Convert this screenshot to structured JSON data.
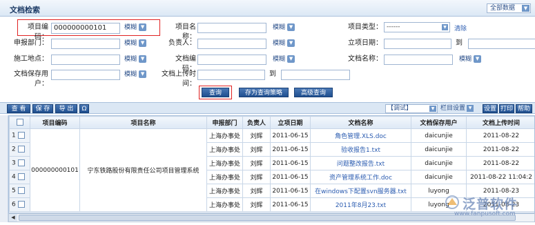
{
  "header": {
    "title": "文档检索",
    "all_data": "全部数据"
  },
  "form": {
    "project_code_label": "项目编码：",
    "project_code_value": "000000000101",
    "project_code_mode": "模糊",
    "project_name_label": "项目名称：",
    "project_name_mode": "模糊",
    "project_type_label": "项目类型：",
    "project_type_value": "------",
    "clear_label": "清除",
    "dept_label": "申报部门：",
    "dept_mode": "模糊",
    "owner_label": "负责人：",
    "owner_mode": "模糊",
    "setup_date_label": "立项日期：",
    "to_label": "到",
    "site_label": "施工地点：",
    "site_mode": "模糊",
    "doc_code_label": "文档编码：",
    "doc_code_mode": "模糊",
    "doc_name_label": "文档名称：",
    "doc_name_mode": "模糊",
    "doc_user_label": "文档保存用户：",
    "doc_user_mode": "模糊",
    "upload_time_label": "文档上传时间：",
    "upload_to_label": "到"
  },
  "buttons": {
    "query": "查询",
    "save_strategy": "存为查询策略",
    "advanced": "高级查询"
  },
  "toolbar": {
    "view": "查 看",
    "save": "保 存",
    "export": "导 出",
    "omega": "Ω",
    "debug_select": "【调试】",
    "column_settings": "栏目设置",
    "settings": "设置",
    "print": "打印",
    "help": "帮助"
  },
  "table": {
    "columns": [
      "",
      "项目编码",
      "项目名称",
      "申报部门",
      "负责人",
      "立项日期",
      "文档名称",
      "文档保存用户",
      "文档上传时间"
    ],
    "project_code": "000000000101",
    "project_name": "宁东铁路股份有限责任公司项目管理系统",
    "rows": [
      {
        "n": "1",
        "dept": "上海办事处",
        "owner": "刘辉",
        "date": "2011-06-15",
        "doc": "角色管理.XLS.doc",
        "user": "daicunjie",
        "upload": "2011-08-22"
      },
      {
        "n": "2",
        "dept": "上海办事处",
        "owner": "刘辉",
        "date": "2011-06-15",
        "doc": "验收报告1.txt",
        "user": "daicunjie",
        "upload": "2011-08-22"
      },
      {
        "n": "3",
        "dept": "上海办事处",
        "owner": "刘辉",
        "date": "2011-06-15",
        "doc": "问题整改报告.txt",
        "user": "daicunjie",
        "upload": "2011-08-22"
      },
      {
        "n": "4",
        "dept": "上海办事处",
        "owner": "刘辉",
        "date": "2011-06-15",
        "doc": "资产管理系统工作.doc",
        "user": "daicunjie",
        "upload": "2011-08-22 11:04:2"
      },
      {
        "n": "5",
        "dept": "上海办事处",
        "owner": "刘辉",
        "date": "2011-06-15",
        "doc": "在windows下配置svn服务器.txt",
        "user": "luyong",
        "upload": "2011-08-23"
      },
      {
        "n": "6",
        "dept": "上海办事处",
        "owner": "刘辉",
        "date": "2011-06-15",
        "doc": "2011年8月23.txt",
        "user": "luyong",
        "upload": "2011-08-23"
      }
    ]
  },
  "watermark": {
    "brand": "泛普软件",
    "url": "www.fanpusoft.com"
  },
  "colors": {
    "accent": "#1f4f8f",
    "highlight": "#e02020",
    "link": "#2a5bb0"
  }
}
